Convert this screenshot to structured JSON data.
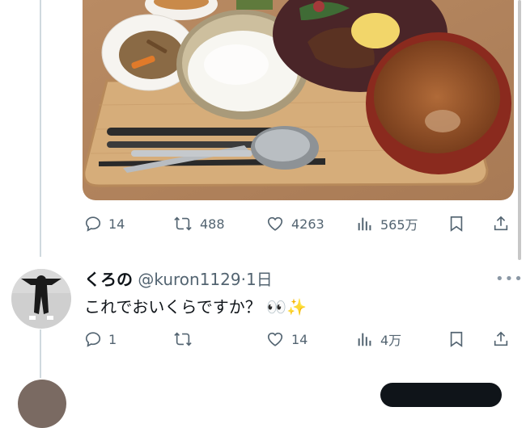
{
  "top_tweet": {
    "image_alt_icon": "meal-photo",
    "actions": {
      "reply_count": "14",
      "retweet_count": "488",
      "like_count": "4263",
      "view_count": "565万"
    }
  },
  "reply": {
    "display_name": "くろの",
    "handle": "@kuron1129",
    "separator": "·",
    "time": "1日",
    "text": "これでおいくらですか？",
    "emoji": "👀✨",
    "actions": {
      "reply_count": "1",
      "retweet_count": "",
      "like_count": "14",
      "view_count": "4万"
    }
  },
  "colors": {
    "text_primary": "#0f1419",
    "text_secondary": "#536471",
    "thread_line": "#cfd9de"
  },
  "icons": [
    "reply-icon",
    "retweet-icon",
    "like-icon",
    "views-icon",
    "bookmark-icon",
    "share-icon",
    "more-icon"
  ]
}
